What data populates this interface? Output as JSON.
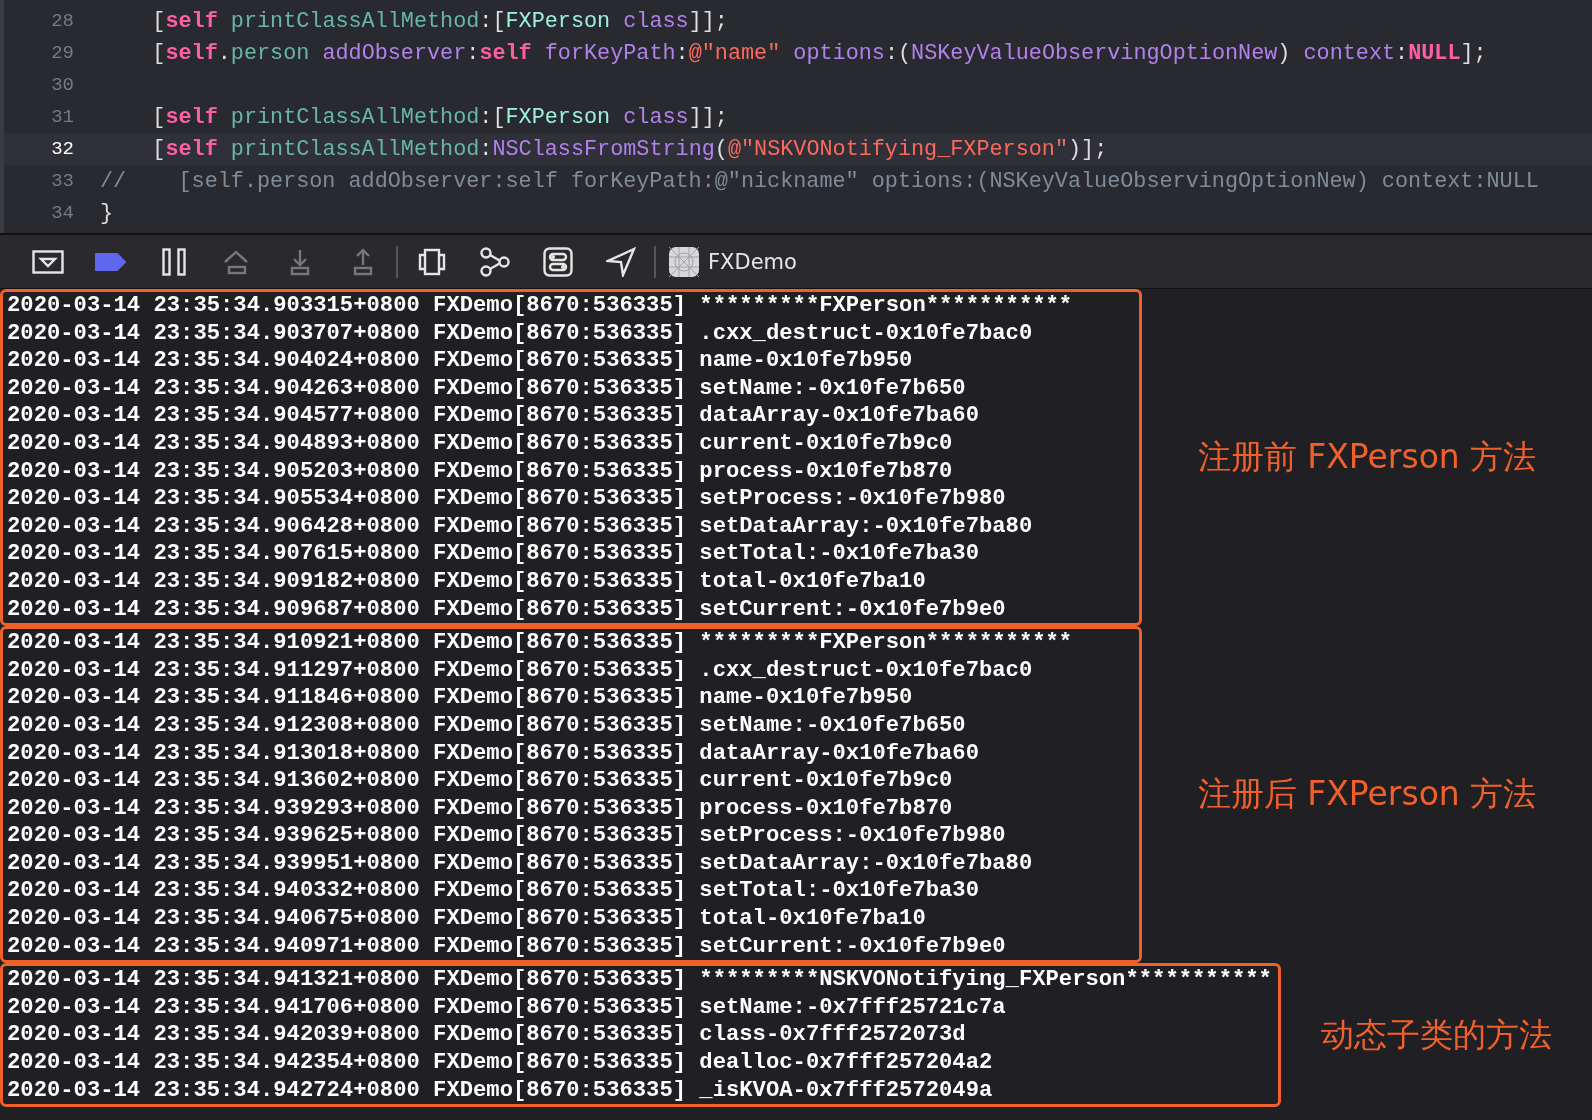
{
  "editor": {
    "lines": [
      {
        "number": "28",
        "current": false,
        "tokens": [
          {
            "kind": "plain",
            "text": "    ["
          },
          {
            "kind": "keyword",
            "text": "self"
          },
          {
            "kind": "method",
            "text": " printClassAllMethod"
          },
          {
            "kind": "plain",
            "text": ":["
          },
          {
            "kind": "type",
            "text": "FXPerson"
          },
          {
            "kind": "api",
            "text": " class"
          },
          {
            "kind": "plain",
            "text": "]];"
          }
        ]
      },
      {
        "number": "29",
        "current": false,
        "tokens": [
          {
            "kind": "plain",
            "text": "    ["
          },
          {
            "kind": "keyword",
            "text": "self"
          },
          {
            "kind": "plain",
            "text": "."
          },
          {
            "kind": "method",
            "text": "person"
          },
          {
            "kind": "api",
            "text": " addObserver"
          },
          {
            "kind": "plain",
            "text": ":"
          },
          {
            "kind": "keyword",
            "text": "self"
          },
          {
            "kind": "api",
            "text": " forKeyPath"
          },
          {
            "kind": "plain",
            "text": ":"
          },
          {
            "kind": "string",
            "text": "@\"name\""
          },
          {
            "kind": "api",
            "text": " options"
          },
          {
            "kind": "plain",
            "text": ":("
          },
          {
            "kind": "api",
            "text": "NSKeyValueObservingOptionNew"
          },
          {
            "kind": "plain",
            "text": ") "
          },
          {
            "kind": "api",
            "text": "context"
          },
          {
            "kind": "plain",
            "text": ":"
          },
          {
            "kind": "keyword",
            "text": "NULL"
          },
          {
            "kind": "plain",
            "text": "];"
          }
        ]
      },
      {
        "number": "30",
        "current": false
      },
      {
        "number": "31",
        "current": false,
        "tokens": [
          {
            "kind": "plain",
            "text": "    ["
          },
          {
            "kind": "keyword",
            "text": "self"
          },
          {
            "kind": "method",
            "text": " printClassAllMethod"
          },
          {
            "kind": "plain",
            "text": ":["
          },
          {
            "kind": "type",
            "text": "FXPerson"
          },
          {
            "kind": "api",
            "text": " class"
          },
          {
            "kind": "plain",
            "text": "]];"
          }
        ]
      },
      {
        "number": "32",
        "current": true,
        "tokens": [
          {
            "kind": "plain",
            "text": "    ["
          },
          {
            "kind": "keyword",
            "text": "self"
          },
          {
            "kind": "method",
            "text": " printClassAllMethod"
          },
          {
            "kind": "plain",
            "text": ":"
          },
          {
            "kind": "api",
            "text": "NSClassFromString"
          },
          {
            "kind": "plain",
            "text": "("
          },
          {
            "kind": "string",
            "text": "@\"NSKVONotifying_FXPerson\""
          },
          {
            "kind": "plain",
            "text": ")];"
          }
        ]
      },
      {
        "number": "33",
        "current": false,
        "tokens": [
          {
            "kind": "comment",
            "text": "//    [self.person addObserver:self forKeyPath:@\"nickname\" options:(NSKeyValueObservingOptionNew) context:NULL"
          }
        ]
      },
      {
        "number": "34",
        "current": false,
        "tokens": [
          {
            "kind": "plain",
            "text": "}"
          }
        ]
      }
    ]
  },
  "toolbar": {
    "breakpoints_active": true,
    "step_controls_enabled": false,
    "scheme": "FXDemo"
  },
  "console": {
    "groups": [
      {
        "annotation": "注册前 FXPerson 方法",
        "lines": [
          "2020-03-14 23:35:34.903315+0800 FXDemo[8670:536335] *********FXPerson***********",
          "2020-03-14 23:35:34.903707+0800 FXDemo[8670:536335] .cxx_destruct-0x10fe7bac0",
          "2020-03-14 23:35:34.904024+0800 FXDemo[8670:536335] name-0x10fe7b950",
          "2020-03-14 23:35:34.904263+0800 FXDemo[8670:536335] setName:-0x10fe7b650",
          "2020-03-14 23:35:34.904577+0800 FXDemo[8670:536335] dataArray-0x10fe7ba60",
          "2020-03-14 23:35:34.904893+0800 FXDemo[8670:536335] current-0x10fe7b9c0",
          "2020-03-14 23:35:34.905203+0800 FXDemo[8670:536335] process-0x10fe7b870",
          "2020-03-14 23:35:34.905534+0800 FXDemo[8670:536335] setProcess:-0x10fe7b980",
          "2020-03-14 23:35:34.906428+0800 FXDemo[8670:536335] setDataArray:-0x10fe7ba80",
          "2020-03-14 23:35:34.907615+0800 FXDemo[8670:536335] setTotal:-0x10fe7ba30",
          "2020-03-14 23:35:34.909182+0800 FXDemo[8670:536335] total-0x10fe7ba10",
          "2020-03-14 23:35:34.909687+0800 FXDemo[8670:536335] setCurrent:-0x10fe7b9e0"
        ]
      },
      {
        "annotation": "注册后 FXPerson 方法",
        "lines": [
          "2020-03-14 23:35:34.910921+0800 FXDemo[8670:536335] *********FXPerson***********",
          "2020-03-14 23:35:34.911297+0800 FXDemo[8670:536335] .cxx_destruct-0x10fe7bac0",
          "2020-03-14 23:35:34.911846+0800 FXDemo[8670:536335] name-0x10fe7b950",
          "2020-03-14 23:35:34.912308+0800 FXDemo[8670:536335] setName:-0x10fe7b650",
          "2020-03-14 23:35:34.913018+0800 FXDemo[8670:536335] dataArray-0x10fe7ba60",
          "2020-03-14 23:35:34.913602+0800 FXDemo[8670:536335] current-0x10fe7b9c0",
          "2020-03-14 23:35:34.939293+0800 FXDemo[8670:536335] process-0x10fe7b870",
          "2020-03-14 23:35:34.939625+0800 FXDemo[8670:536335] setProcess:-0x10fe7b980",
          "2020-03-14 23:35:34.939951+0800 FXDemo[8670:536335] setDataArray:-0x10fe7ba80",
          "2020-03-14 23:35:34.940332+0800 FXDemo[8670:536335] setTotal:-0x10fe7ba30",
          "2020-03-14 23:35:34.940675+0800 FXDemo[8670:536335] total-0x10fe7ba10",
          "2020-03-14 23:35:34.940971+0800 FXDemo[8670:536335] setCurrent:-0x10fe7b9e0"
        ]
      },
      {
        "annotation": "动态子类的方法",
        "lines": [
          "2020-03-14 23:35:34.941321+0800 FXDemo[8670:536335] *********NSKVONotifying_FXPerson***********",
          "2020-03-14 23:35:34.941706+0800 FXDemo[8670:536335] setName:-0x7fff25721c7a",
          "2020-03-14 23:35:34.942039+0800 FXDemo[8670:536335] class-0x7fff2572073d",
          "2020-03-14 23:35:34.942354+0800 FXDemo[8670:536335] dealloc-0x7fff257204a2",
          "2020-03-14 23:35:34.942724+0800 FXDemo[8670:536335] _isKVOA-0x7fff2572049a"
        ]
      }
    ]
  }
}
